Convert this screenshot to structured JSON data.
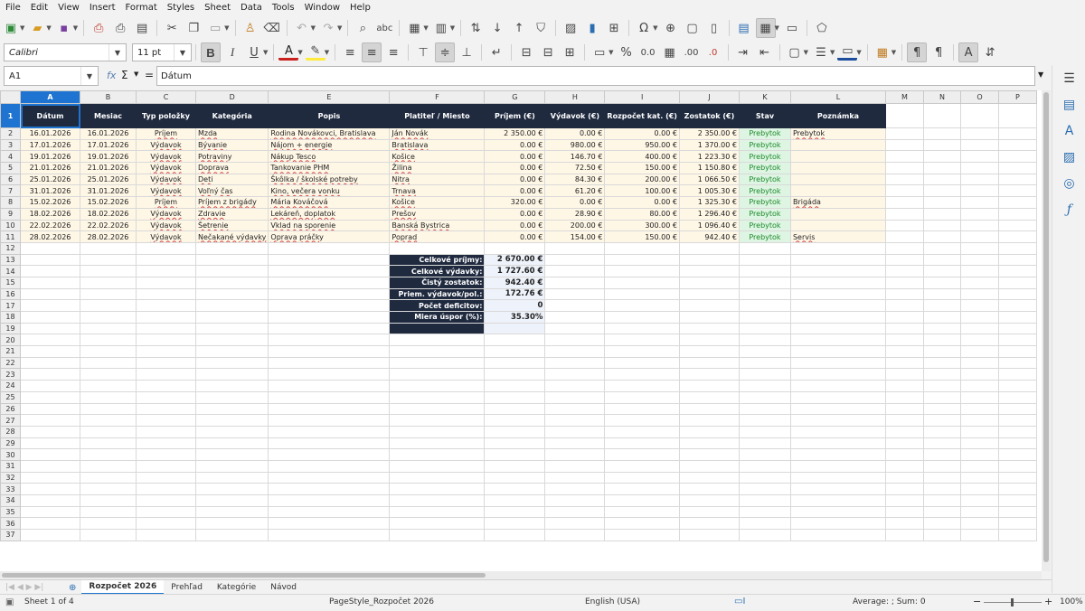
{
  "menu": [
    "File",
    "Edit",
    "View",
    "Insert",
    "Format",
    "Styles",
    "Sheet",
    "Data",
    "Tools",
    "Window",
    "Help"
  ],
  "toolbar": {
    "font_name": "Calibri",
    "font_size": "11 pt",
    "bold": "B",
    "italic": "I",
    "underline": "U",
    "percent": "%",
    "decimal_a": ".00",
    "decimal_b": ".0"
  },
  "formula_bar": {
    "name_box": "A1",
    "fx": "fx",
    "sigma": "Σ",
    "equals": "=",
    "content": "Dátum"
  },
  "columns": [
    "A",
    "B",
    "C",
    "D",
    "E",
    "F",
    "G",
    "H",
    "I",
    "J",
    "K",
    "L",
    "M",
    "N",
    "O",
    "P"
  ],
  "selected_column": "A",
  "header_row": [
    "Dátum",
    "Mesiac",
    "Typ položky",
    "Kategória",
    "Popis",
    "Platiteľ / Miesto",
    "Príjem (€)",
    "Výdavok (€)",
    "Rozpočet kat. (€)",
    "Zostatok (€)",
    "Stav",
    "Poznámka"
  ],
  "rows": [
    [
      "16.01.2026",
      "16.01.2026",
      "Príjem",
      "Mzda",
      "Rodina Novákovci, Bratislava",
      "Ján Novák",
      "2 350.00 €",
      "0.00 €",
      "0.00 €",
      "2 350.00 €",
      "Prebytok",
      "Prebytok"
    ],
    [
      "17.01.2026",
      "17.01.2026",
      "Výdavok",
      "Bývanie",
      "Nájom + energie",
      "Bratislava",
      "0.00 €",
      "980.00 €",
      "950.00 €",
      "1 370.00 €",
      "Prebytok",
      ""
    ],
    [
      "19.01.2026",
      "19.01.2026",
      "Výdavok",
      "Potraviny",
      "Nákup Tesco",
      "Košice",
      "0.00 €",
      "146.70 €",
      "400.00 €",
      "1 223.30 €",
      "Prebytok",
      ""
    ],
    [
      "21.01.2026",
      "21.01.2026",
      "Výdavok",
      "Doprava",
      "Tankovanie PHM",
      "Žilina",
      "0.00 €",
      "72.50 €",
      "150.00 €",
      "1 150.80 €",
      "Prebytok",
      ""
    ],
    [
      "25.01.2026",
      "25.01.2026",
      "Výdavok",
      "Deti",
      "Škôlka / školské potreby",
      "Nitra",
      "0.00 €",
      "84.30 €",
      "200.00 €",
      "1 066.50 €",
      "Prebytok",
      ""
    ],
    [
      "31.01.2026",
      "31.01.2026",
      "Výdavok",
      "Voľný čas",
      "Kino, večera vonku",
      "Trnava",
      "0.00 €",
      "61.20 €",
      "100.00 €",
      "1 005.30 €",
      "Prebytok",
      ""
    ],
    [
      "15.02.2026",
      "15.02.2026",
      "Príjem",
      "Príjem z brigády",
      "Mária Kováčová",
      "Košice",
      "320.00 €",
      "0.00 €",
      "0.00 €",
      "1 325.30 €",
      "Prebytok",
      "Brigáda"
    ],
    [
      "18.02.2026",
      "18.02.2026",
      "Výdavok",
      "Zdravie",
      "Lekáreň, doplatok",
      "Prešov",
      "0.00 €",
      "28.90 €",
      "80.00 €",
      "1 296.40 €",
      "Prebytok",
      ""
    ],
    [
      "22.02.2026",
      "22.02.2026",
      "Výdavok",
      "Šetrenie",
      "Vklad na sporenie",
      "Banská Bystrica",
      "0.00 €",
      "200.00 €",
      "300.00 €",
      "1 096.40 €",
      "Prebytok",
      ""
    ],
    [
      "28.02.2026",
      "28.02.2026",
      "Výdavok",
      "Nečakané výdavky",
      "Oprava práčky",
      "Poprad",
      "0.00 €",
      "154.00 €",
      "150.00 €",
      "942.40 €",
      "Prebytok",
      "Servis"
    ]
  ],
  "summary": [
    {
      "label": "Celkové príjmy:",
      "value": "2 670.00 €"
    },
    {
      "label": "Celkové výdavky:",
      "value": "1 727.60 €"
    },
    {
      "label": "Čistý zostatok:",
      "value": "942.40 €"
    },
    {
      "label": "Priem. výdavok/pol.:",
      "value": "172.76 €"
    },
    {
      "label": "Počet deficitov:",
      "value": "0"
    },
    {
      "label": "Miera úspor (%):",
      "value": "35.30%"
    }
  ],
  "sheet_tabs": [
    "Rozpočet 2026",
    "Prehľad",
    "Kategórie",
    "Návod"
  ],
  "active_tab": "Rozpočet 2026",
  "status": {
    "sheet": "Sheet 1 of 4",
    "page_style": "PageStyle_Rozpočet 2026",
    "language": "English (USA)",
    "summary": "Average: ; Sum: 0",
    "zoom": "100%"
  },
  "colors": {
    "header_bg": "#1f2a3f",
    "selection": "#1e74d0",
    "row_fill": "#fff7e6",
    "status_green": "#1a8a2a"
  }
}
